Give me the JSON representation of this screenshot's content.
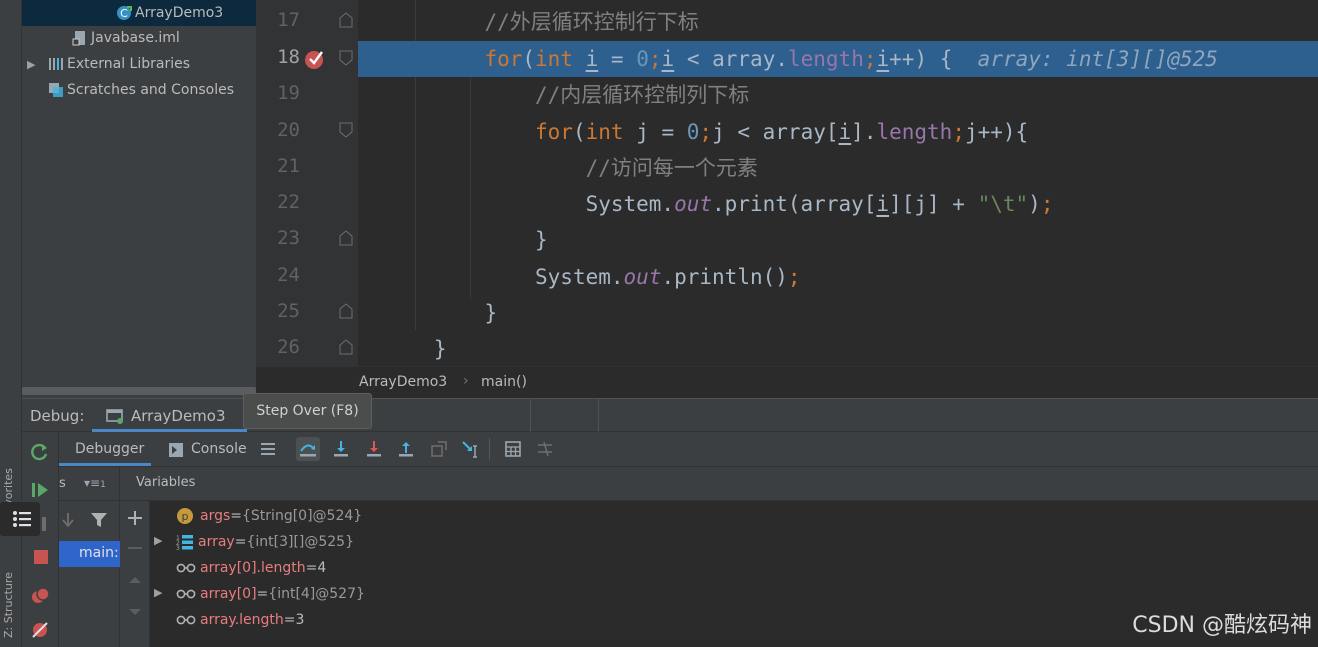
{
  "side_tabs": {
    "favorites": "2: Favorites",
    "structure": "Z: Structure"
  },
  "project_tree": [
    {
      "label": "ArrayDemo3",
      "icon": "java-class-icon",
      "selected": true
    },
    {
      "label": "Javabase.iml",
      "icon": "iml-file-icon"
    },
    {
      "label": "External Libraries",
      "icon": "libraries-icon",
      "expandable": true
    },
    {
      "label": "Scratches and Consoles",
      "icon": "scratches-icon"
    }
  ],
  "editor": {
    "line_numbers": [
      "17",
      "18",
      "19",
      "20",
      "21",
      "22",
      "23",
      "24",
      "25",
      "26"
    ],
    "current_line": "18",
    "lines": {
      "l17": {
        "comment": "//外层循环控制行下标"
      },
      "l18": {
        "kw_for": "for",
        "p1": "(",
        "kw_int": "int",
        "sp1": " ",
        "var_i": "i",
        "p2": " = ",
        "zero": "0",
        "semi1": ";",
        "var_i2": "i",
        "p3": " < array.",
        "length": "length",
        "semi2": ";",
        "var_i3": "i",
        "p4": "++) {",
        "inlay": "array: int[3][]@525"
      },
      "l19": {
        "comment": "//内层循环控制列下标"
      },
      "l20": {
        "kw_for": "for",
        "p1": "(",
        "kw_int": "int",
        "p2": " j = ",
        "zero": "0",
        "semi1": ";",
        "p3": "j < array[",
        "var_i": "i",
        "p4": "].",
        "length": "length",
        "semi2": ";",
        "p5": "j++){"
      },
      "l21": {
        "comment": "//访问每一个元素"
      },
      "l22": {
        "p1": "System.",
        "out": "out",
        "p2": ".print(array[",
        "var_i": "i",
        "p3": "][j] + ",
        "str": "\"\\t\"",
        "p4": ")",
        "semi": ";"
      },
      "l23": {
        "text": "}"
      },
      "l24": {
        "p1": "System.",
        "out": "out",
        "p2": ".println()",
        "semi": ";"
      },
      "l25": {
        "text": "}"
      },
      "l26": {
        "text": "}"
      }
    }
  },
  "breadcrumb": {
    "class": "ArrayDemo3",
    "method": "main()"
  },
  "debug": {
    "label": "Debug:",
    "session": "ArrayDemo3",
    "tooltip": "Step Over (F8)",
    "tabs": {
      "debugger": "Debugger",
      "console": "Console"
    },
    "frames_tab": "s",
    "frames_filter": "≡",
    "frames_thread_badge": "1",
    "frame_item": "main:",
    "variables_tab": "Variables",
    "variables": [
      {
        "icon": "parameter-icon",
        "icon_letter": "p",
        "name": "args",
        "eq": " = ",
        "value": "{String[0]@524}",
        "expandable": false
      },
      {
        "icon": "array-icon",
        "name": "array",
        "eq": " = ",
        "value": "{int[3][]@525}",
        "expandable": true
      },
      {
        "icon": "watch-glasses-icon",
        "name": "array[0].length",
        "eq": " = ",
        "value": "4",
        "expandable": false,
        "plain_value": true
      },
      {
        "icon": "watch-glasses-icon",
        "name": "array[0]",
        "eq": " = ",
        "value": "{int[4]@527}",
        "expandable": true
      },
      {
        "icon": "watch-glasses-icon",
        "name": "array.length",
        "eq": " = ",
        "value": "3",
        "expandable": false,
        "plain_value": true
      }
    ]
  },
  "watermark": "CSDN @酷炫码神",
  "colors": {
    "exec_line": "#2d5f8f",
    "keyword": "#cc7832",
    "number": "#6897bb",
    "field": "#9876aa",
    "comment": "#808080",
    "string": "#6a8759",
    "breakpoint": "#c75450"
  }
}
